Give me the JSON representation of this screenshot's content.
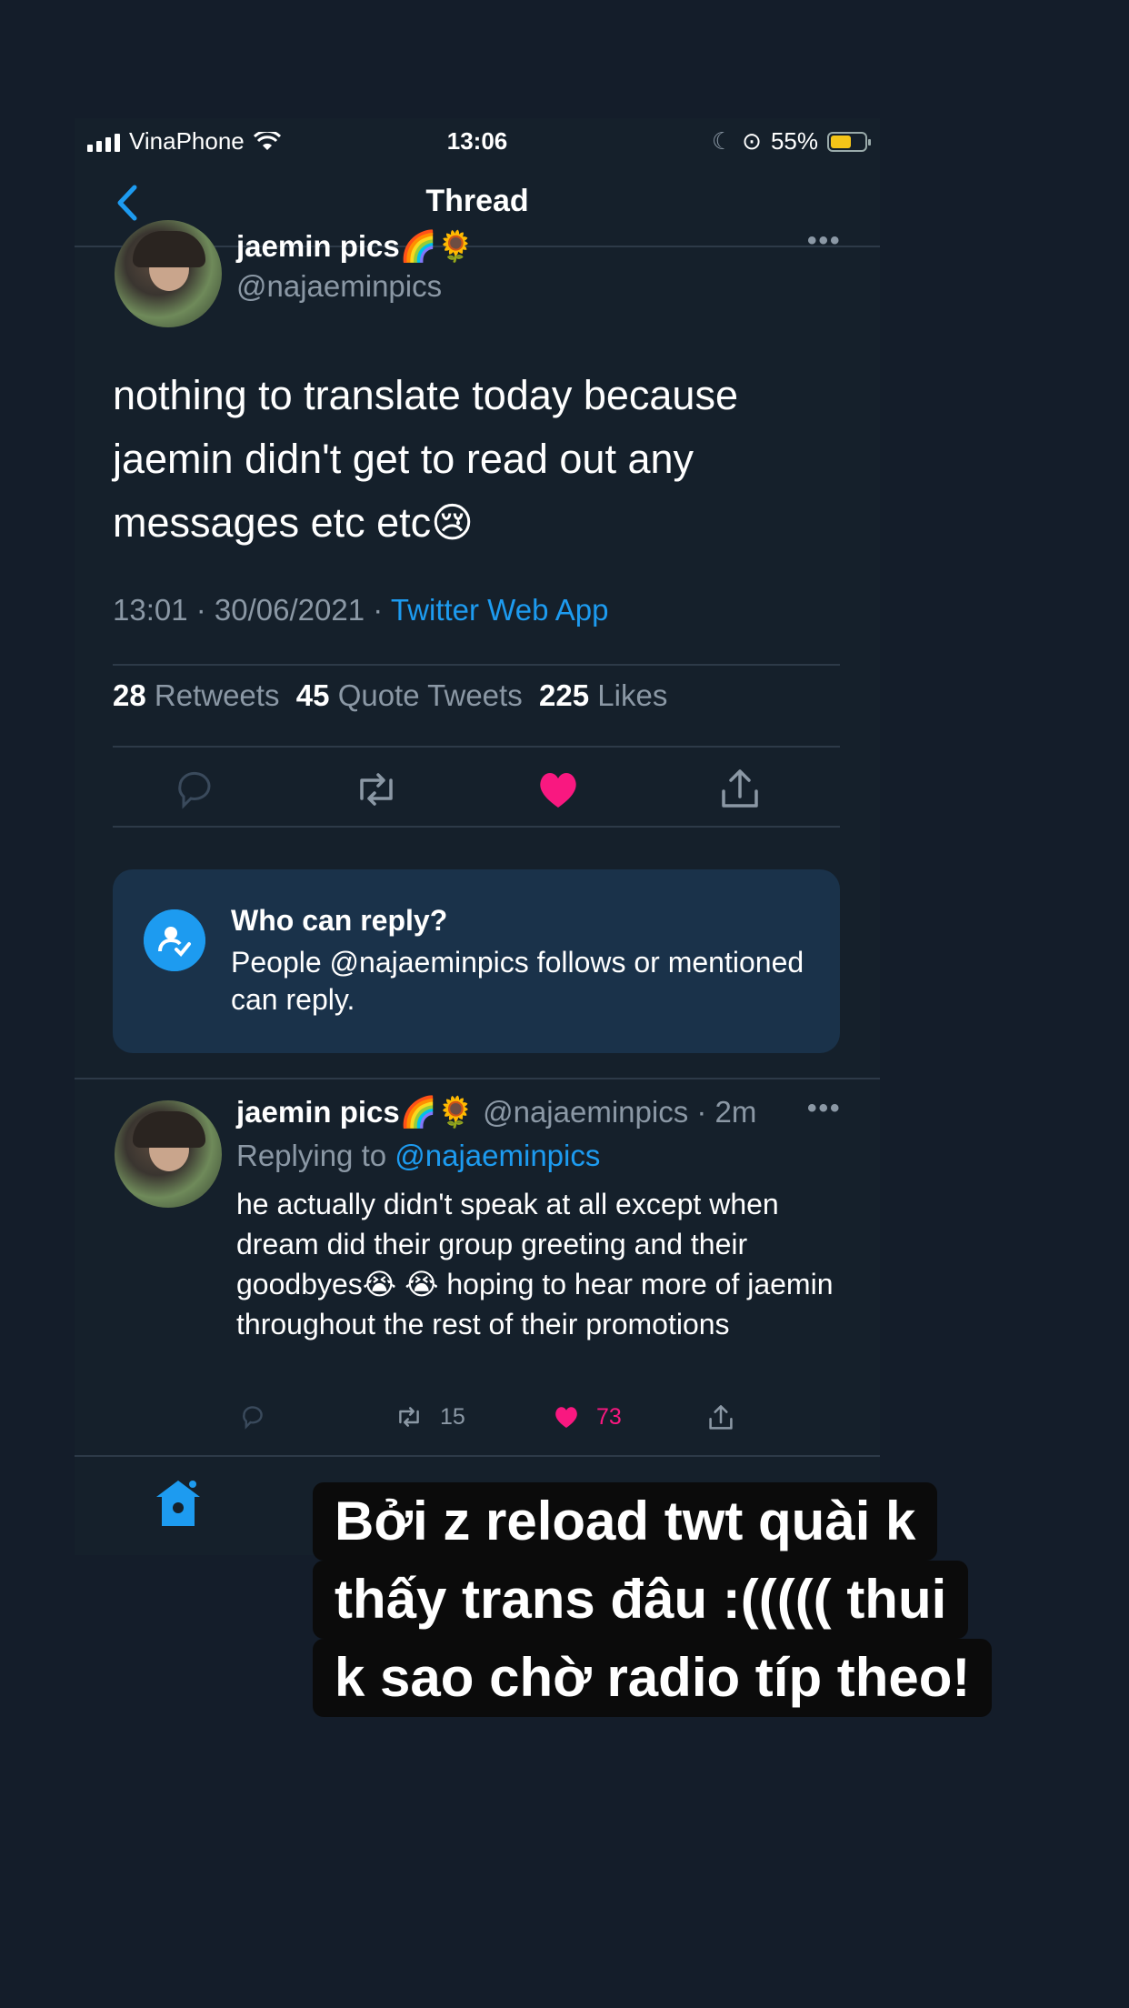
{
  "status": {
    "carrier": "VinaPhone",
    "time": "13:06",
    "battery": "55%",
    "battery_color": "#f5c518"
  },
  "header": {
    "title": "Thread"
  },
  "tweet": {
    "name": "jaemin pics🌈🌻",
    "handle": "@najaeminpics",
    "text": "nothing to translate today because jaemin didn't get to read out any messages etc etc😢",
    "timestamp": "13:01 · 30/06/2021 · ",
    "source": "Twitter Web App",
    "retweets": "28",
    "retweets_label": "Retweets",
    "quotes": "45",
    "quotes_label": "Quote Tweets",
    "likes": "225",
    "likes_label": "Likes",
    "icons": [
      "reply-icon",
      "retweet-icon",
      "heart-icon-liked",
      "share-icon"
    ],
    "accent": "#1d9bf0",
    "like_color": "#f91880"
  },
  "reply_restriction": {
    "heading": "Who can reply?",
    "body": "People @najaeminpics follows or mentioned can reply."
  },
  "reply": {
    "name": "jaemin pics🌈🌻",
    "handle_time": " @najaeminpics · 2m",
    "replying_prefix": "Replying to ",
    "replying_handle": "@najaeminpics",
    "text": "he actually didn't speak at all except when dream did their group greeting and their goodbyes😭 😭 hoping to hear more of jaemin throughout the rest of their promotions",
    "retweets": "15",
    "likes": "73"
  },
  "caption": {
    "line1": "Bởi z reload twt quài k",
    "line2": "thấy trans đâu :((((( thui",
    "line3": "k sao chờ radio típ theo!"
  }
}
